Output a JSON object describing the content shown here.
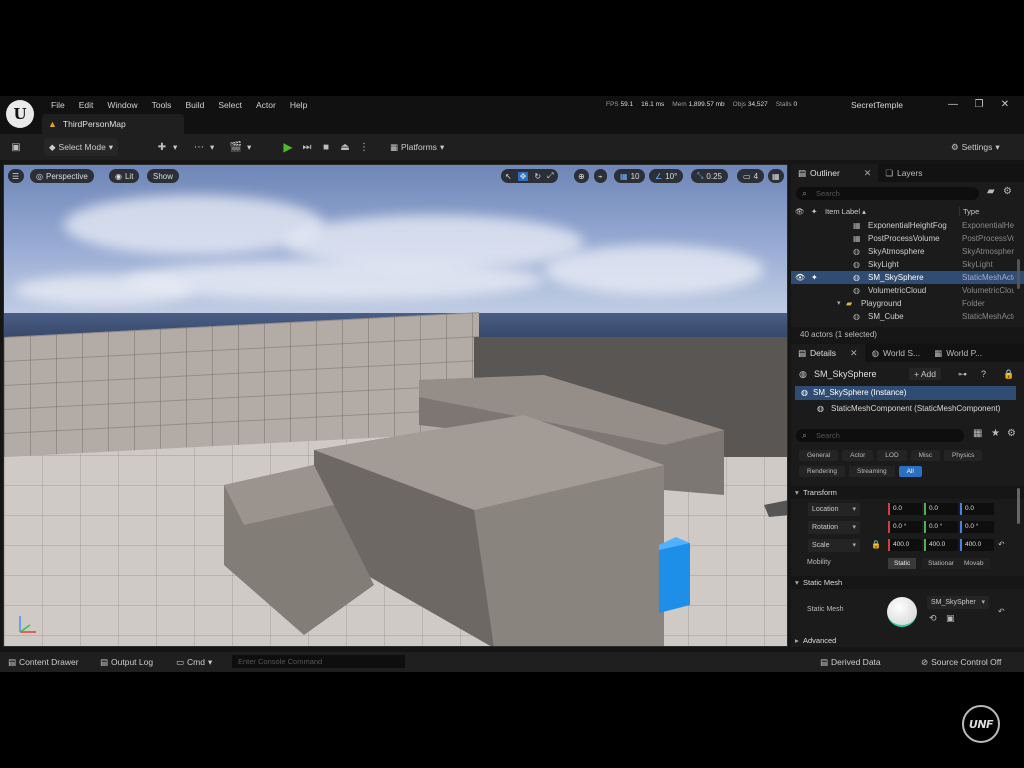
{
  "title_bar": {
    "menu": [
      "File",
      "Edit",
      "Window",
      "Tools",
      "Build",
      "Select",
      "Actor",
      "Help"
    ],
    "stats": [
      {
        "label": "FPS",
        "value": "59.1"
      },
      {
        "label": "",
        "value": "16.1 ms"
      },
      {
        "label": "Mem",
        "value": "1,899.57 mb"
      },
      {
        "label": "Objs",
        "value": "34,527"
      },
      {
        "label": "Stalls",
        "value": "0"
      }
    ],
    "project_name": "SecretTemple",
    "map_tab": "ThirdPersonMap",
    "window_buttons": [
      "—",
      "❐",
      "✕"
    ]
  },
  "toolbar": {
    "save_icon": "save-icon",
    "select_mode": "Select Mode",
    "platforms": "Platforms",
    "settings": "Settings"
  },
  "viewport": {
    "perspective": "Perspective",
    "lit": "Lit",
    "show": "Show",
    "grid_snap": "10",
    "rotation_snap": "10°",
    "scale_snap": "0.25",
    "camera_speed": "4"
  },
  "outliner": {
    "tab_outliner": "Outliner",
    "tab_layers": "Layers",
    "search_placeholder": "Search",
    "col_label": "Item Label ▴",
    "col_type": "Type",
    "rows": [
      {
        "label": "ExponentialHeightFog",
        "type": "ExponentialHeightFog"
      },
      {
        "label": "PostProcessVolume",
        "type": "PostProcessVolume"
      },
      {
        "label": "SkyAtmosphere",
        "type": "SkyAtmosphere"
      },
      {
        "label": "SkyLight",
        "type": "SkyLight"
      },
      {
        "label": "SM_SkySphere",
        "type": "StaticMeshActor"
      },
      {
        "label": "VolumetricCloud",
        "type": "VolumetricCloud"
      },
      {
        "label": "Playground",
        "type": "Folder"
      },
      {
        "label": "SM_Cube",
        "type": "StaticMeshActor"
      }
    ],
    "footer": "40 actors (1 selected)"
  },
  "details": {
    "tab_details": "Details",
    "tab_world1": "World S...",
    "tab_world2": "World P...",
    "actor_name": "SM_SkySphere",
    "add_label": "+ Add",
    "instance_row": "SM_SkySphere (Instance)",
    "component_row": "StaticMeshComponent (StaticMeshComponent)",
    "search_placeholder": "Search",
    "categories_row1": [
      "General",
      "Actor",
      "LOD",
      "Misc",
      "Physics"
    ],
    "categories_row2": [
      "Rendering",
      "Streaming",
      "All"
    ],
    "section_transform": "Transform",
    "location_label": "Location",
    "location": [
      "0.0",
      "0.0",
      "0.0"
    ],
    "rotation_label": "Rotation",
    "rotation": [
      "0.0 °",
      "0.0 °",
      "0.0 °"
    ],
    "scale_label": "Scale",
    "scale": [
      "400.0",
      "400.0",
      "400.0"
    ],
    "mobility_label": "Mobility",
    "mobility_options": [
      "Static",
      "Stationar",
      "Movab"
    ],
    "section_static_mesh": "Static Mesh",
    "static_mesh_label": "Static Mesh",
    "static_mesh_value": "SM_SkySpher",
    "section_advanced": "Advanced"
  },
  "status_bar": {
    "content_drawer": "Content Drawer",
    "output_log": "Output Log",
    "cmd": "Cmd",
    "console_placeholder": "Enter Console Command",
    "derived_data": "Derived Data",
    "source_control": "Source Control Off"
  },
  "watermark": "UNF",
  "colors": {
    "accent_blue": "#2a6fc0",
    "selection": "#2f4d72",
    "play_green": "#4cbb2a",
    "warning_orange": "#e0a030"
  }
}
